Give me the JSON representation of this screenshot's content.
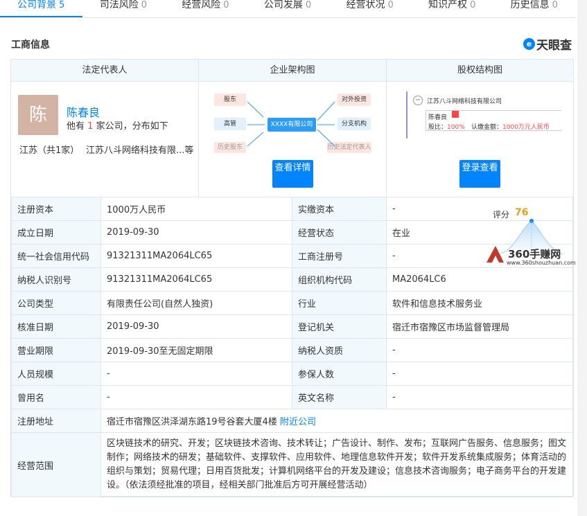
{
  "tabs": [
    {
      "label": "公司背景",
      "count": "5",
      "active": true
    },
    {
      "label": "司法风险",
      "count": "0"
    },
    {
      "label": "经营风险",
      "count": "0"
    },
    {
      "label": "公司发展",
      "count": "0"
    },
    {
      "label": "经营状况",
      "count": "0"
    },
    {
      "label": "知识产权",
      "count": "0"
    },
    {
      "label": "历史信息",
      "count": "0"
    }
  ],
  "section_title": "工商信息",
  "brand": {
    "logo_char": "e",
    "name": "天眼查"
  },
  "headers": {
    "legal_rep": "法定代表人",
    "org_chart": "企业架构图",
    "equity_chart": "股权结构图"
  },
  "legal_rep": {
    "avatar_char": "陈",
    "name": "陈春良",
    "sub_prefix": "他有",
    "sub_count": "1",
    "sub_suffix": "家公司，分布如下",
    "region": "江苏（共1家）",
    "company": "江苏八斗网络科技有限...等"
  },
  "org_chart": {
    "nodes": [
      "股东",
      "高管",
      "历史股东",
      "XXXX有限公司",
      "对外投资",
      "分支机构",
      "历史法定代表人"
    ],
    "button": "查看详情"
  },
  "equity_chart": {
    "company": "江苏八斗网络科技有限公司",
    "person": "陈春良",
    "ratio_label": "股比：",
    "ratio": "100%",
    "amount_label": "认缴金额：",
    "amount": "1000万元人民币",
    "button": "登录查看"
  },
  "score": {
    "label": "评分",
    "value": "76"
  },
  "watermark": {
    "text": "360手赚网",
    "url": "www.360shouzhuan.com"
  },
  "rows": [
    {
      "l1": "注册资本",
      "v1": "1000万人民币",
      "l2": "实缴资本",
      "v2": "-"
    },
    {
      "l1": "成立日期",
      "v1": "2019-09-30",
      "l2": "经营状态",
      "v2": "在业"
    },
    {
      "l1": "统一社会信用代码",
      "v1": "91321311MA2064LC65",
      "l2": "工商注册号",
      "v2": "-"
    },
    {
      "l1": "纳税人识别号",
      "v1": "91321311MA2064LC65",
      "l2": "组织机构代码",
      "v2": "MA2064LC6"
    },
    {
      "l1": "公司类型",
      "v1": "有限责任公司(自然人独资)",
      "l2": "行业",
      "v2": "软件和信息技术服务业"
    },
    {
      "l1": "核准日期",
      "v1": "2019-09-30",
      "l2": "登记机关",
      "v2": "宿迁市宿豫区市场监督管理局"
    },
    {
      "l1": "营业期限",
      "v1": "2019-09-30至无固定期限",
      "l2": "纳税人资质",
      "v2": "-"
    },
    {
      "l1": "人员规模",
      "v1": "-",
      "l2": "参保人数",
      "v2": "-"
    },
    {
      "l1": "曾用名",
      "v1": "-",
      "l2": "英文名称",
      "v2": "-"
    }
  ],
  "address": {
    "label": "注册地址",
    "value": "宿迁市宿豫区洪泽湖东路19号谷套大厦4楼",
    "link": "附近公司"
  },
  "scope": {
    "label": "经营范围",
    "value": "区块链技术的研究、开发；区块链技术咨询、技术转让；广告设计、制作、发布；互联网广告服务、信息服务；图文制作；网络技术的研发；基础软件、支撑软件、应用软件、地理信息软件开发；软件开发系统集成服务；体育活动的组织与策划；贸易代理；日用百货批发；计算机网络平台的开发及建设；信息技术咨询服务；电子商务平台的开发建设。（依法须经批准的项目，经相关部门批准后方可开展经营活动）"
  }
}
